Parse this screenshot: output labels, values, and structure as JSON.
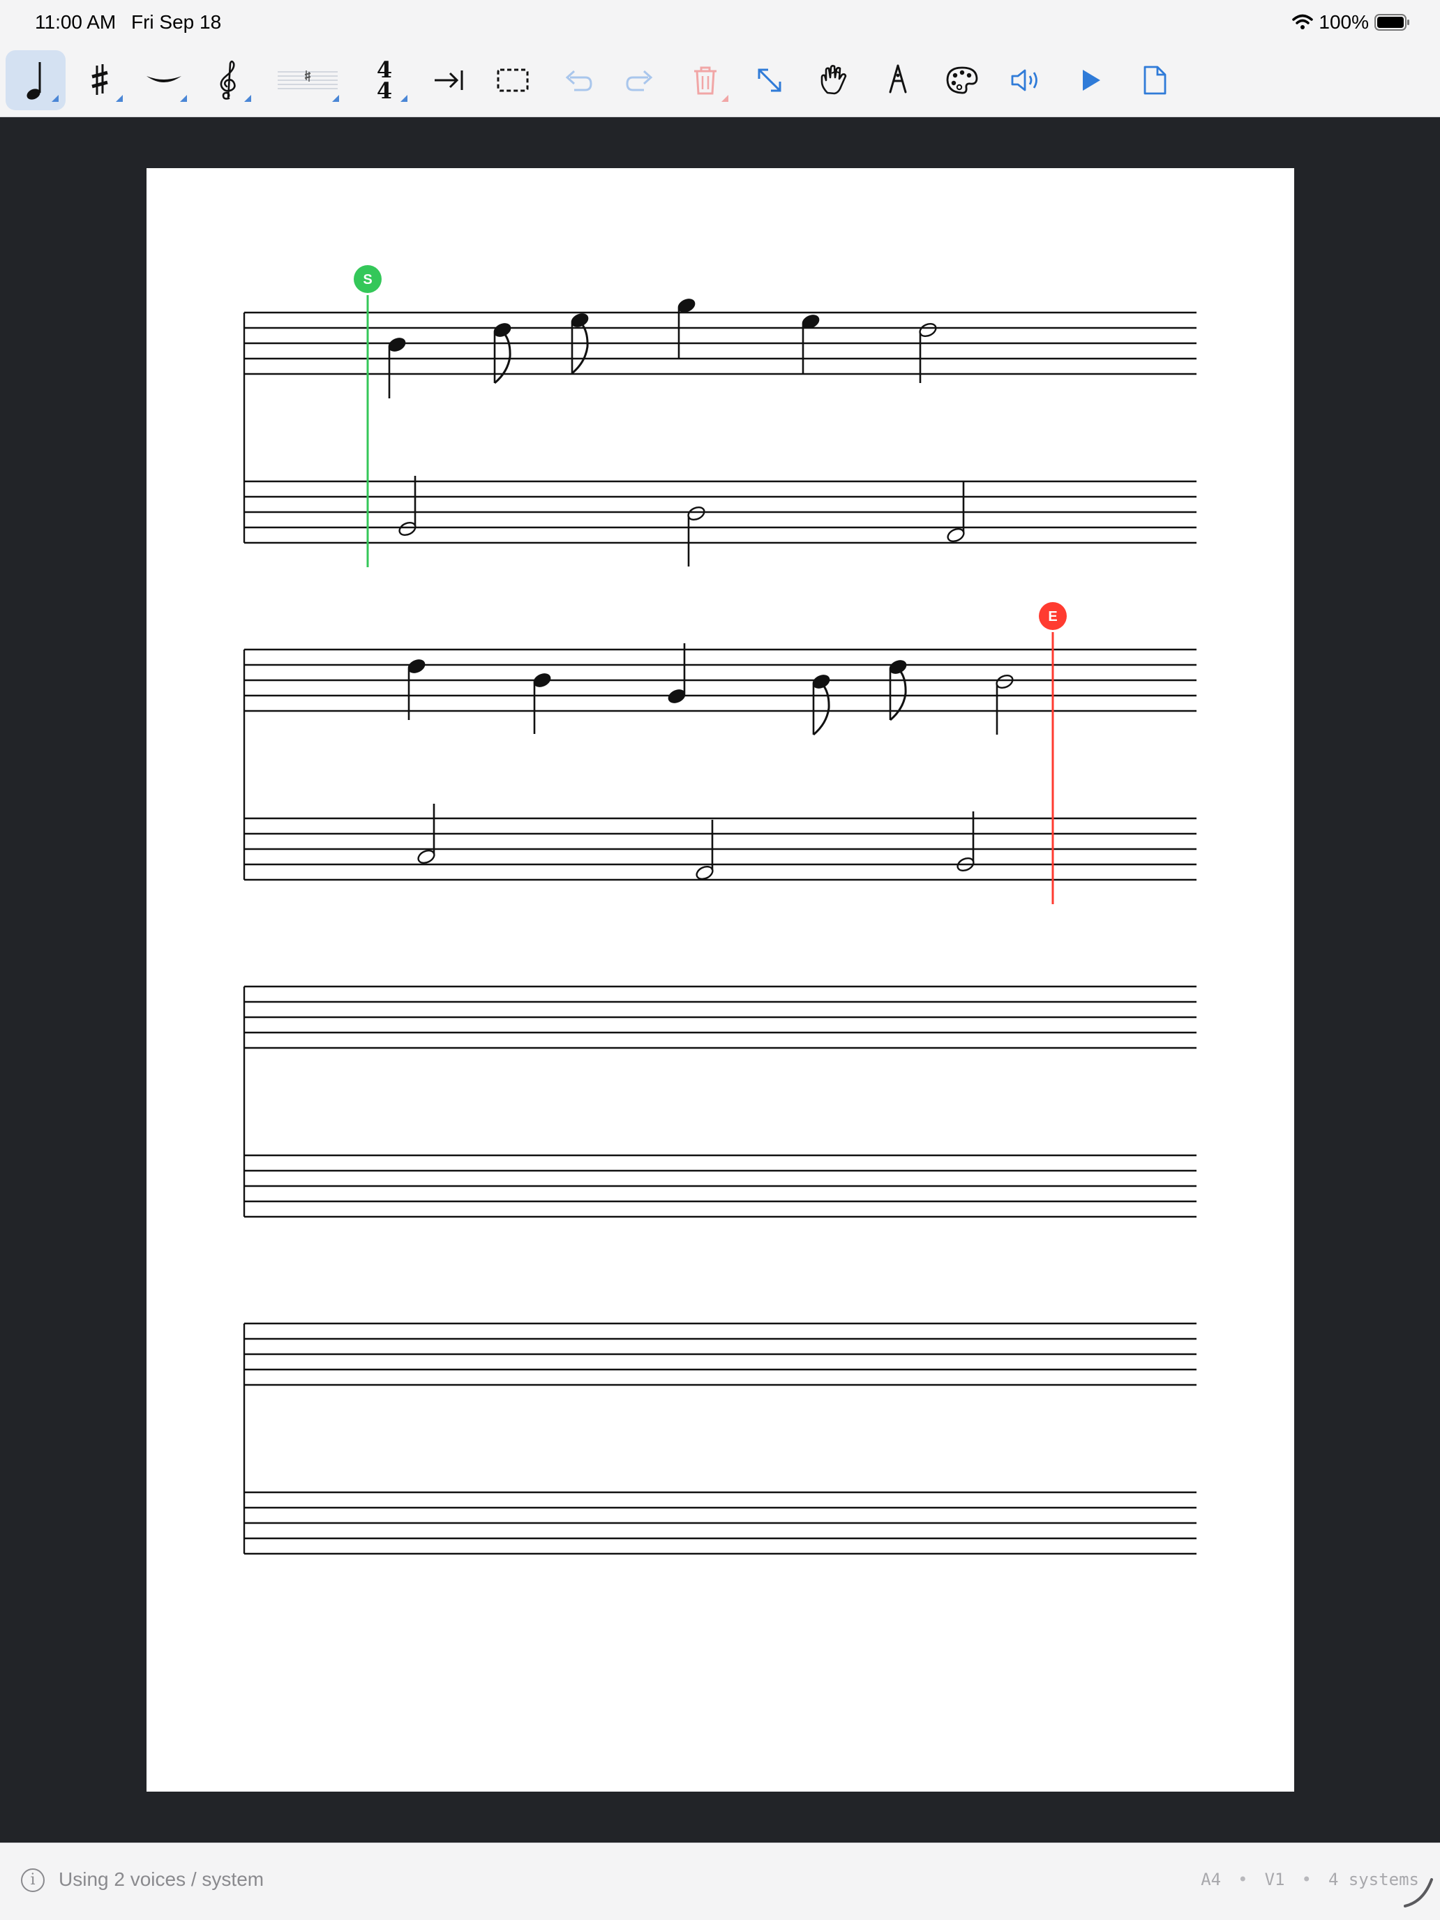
{
  "status": {
    "time": "11:00 AM",
    "date": "Fri Sep 18",
    "battery": "100%"
  },
  "toolbar": {
    "tools": [
      {
        "name": "note-duration-icon",
        "active": true,
        "has_menu": true
      },
      {
        "name": "accidental-sharp-icon",
        "has_menu": true
      },
      {
        "name": "tie-slur-icon",
        "has_menu": true
      },
      {
        "name": "treble-clef-icon",
        "has_menu": true
      },
      {
        "name": "key-signature-icon",
        "has_menu": true
      },
      {
        "name": "time-signature-icon",
        "has_menu": true,
        "text": [
          "4",
          "4"
        ]
      },
      {
        "name": "insert-tab-icon"
      },
      {
        "name": "selection-rect-icon"
      },
      {
        "name": "undo-icon",
        "disabled": true
      },
      {
        "name": "redo-icon",
        "disabled": true
      },
      {
        "name": "trash-icon",
        "disabled": true,
        "has_menu": true
      },
      {
        "name": "expand-icon"
      },
      {
        "name": "hand-tool-icon"
      },
      {
        "name": "pen-nib-icon"
      },
      {
        "name": "palette-icon"
      },
      {
        "name": "speaker-icon"
      },
      {
        "name": "play-icon"
      },
      {
        "name": "document-icon"
      }
    ],
    "accent_color": "#2f7bd8"
  },
  "score": {
    "start_marker_label": "S",
    "end_marker_label": "E",
    "start_color": "#34c759",
    "end_color": "#ff3b30",
    "systems": 4
  },
  "footer": {
    "info_text": "Using 2 voices / system",
    "page_size": "A4",
    "version": "V1",
    "systems_text": "4 systems"
  }
}
